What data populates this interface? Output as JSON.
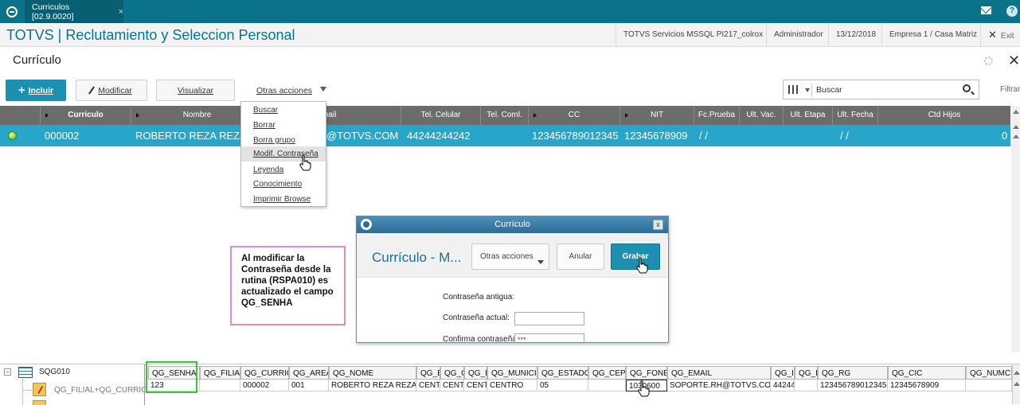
{
  "topbar": {
    "tab_label": "Curriculos [02.9.0020]",
    "tab_close": "×",
    "help": "?"
  },
  "header": {
    "app_title": "TOTVS | Reclutamiento y Seleccion Personal",
    "environment": "TOTVS Servicios MSSQL PI217_colrox",
    "user": "Administrador",
    "date": "13/12/2018",
    "company": "Empresa 1 / Casa Matriz",
    "exit_x": "✕",
    "exit_label": "Exit"
  },
  "page": {
    "title": "Currículo",
    "close": "✕"
  },
  "toolbar": {
    "incluir_plus": "+",
    "incluir": "Incluir",
    "modificar": "Modificar",
    "visualizar": "Visualizar",
    "otras": "Otras acciones"
  },
  "search": {
    "value": "Buscar",
    "filtrar": "Filtrar"
  },
  "grid": {
    "headers": {
      "curriculo": "Curriculo",
      "nombre": "Nombre",
      "email": "mail",
      "tel_celular": "Tel. Celular",
      "tel_coml": "Tel. Coml.",
      "cc": "CC",
      "nit": "NIT",
      "fc_prueba": "Fc.Prueba",
      "ult_vac": "Ult. Vac.",
      "ult_etapa": "Ult. Etapa",
      "ult_fecha": "Ult. Fecha",
      "ctd_hijos": "Ctd Hijos"
    },
    "row": {
      "curriculo": "000002",
      "nombre": "ROBERTO REZA REZA",
      "email": "@TOTVS.COM",
      "tel_celular": "44244244242",
      "cc": "123456789012345",
      "nit": "12345678909",
      "fc_prueba": "/ /",
      "ult_fecha": "/ /",
      "ctd_hijos": "0"
    }
  },
  "menu": {
    "items": [
      "Buscar",
      "Borrar",
      "Borra grupo",
      "Modif. Contraseña",
      "Leyenda",
      "Conocimiento",
      "Imprimir Browse"
    ]
  },
  "dialog": {
    "title": "Currículo",
    "close": "x",
    "heading": "Currículo - M...",
    "otras": "Otras acciones",
    "anular": "Anular",
    "grabar": "Grabar",
    "label_antigua": "Contraseña antigua:",
    "label_actual": "Contraseña actual:",
    "label_confirma": "Confirma contraseña",
    "confirma_value": "***"
  },
  "note": {
    "text": "Al modificar la Contraseña desde la rutina (RSPA010) es actualizado el campo QG_SENHA"
  },
  "tree": {
    "minus": "−",
    "root": "SQG010",
    "child": "QG_FILIAL+QG_CURRIC"
  },
  "dbgrid": {
    "headers": [
      "QG_SENHA",
      "QG_FILIAL",
      "QG_CURRIC",
      "QG_AREA",
      "QG_NOME",
      "QG_E",
      "QG_C",
      "QG_E",
      "QG_MUNICIP",
      "QG_ESTADO",
      "QG_CEP",
      "QG_FONE",
      "QG_EMAIL",
      "QG_I",
      "QG_I",
      "QG_RG",
      "QG_CIC",
      "QG_NUMCP"
    ],
    "row": [
      "123",
      "",
      "000002",
      "001",
      "ROBERTO REZA REZA",
      "CENT",
      "CENT",
      "CENT",
      "CENTRO",
      "05",
      "",
      "1030600",
      "SOPORTE.RH@TOTVS.COM",
      "44244",
      "",
      "123456789012345",
      "12345678909",
      ""
    ]
  },
  "colors": {
    "topbar": "#0b7389",
    "accent": "#1d8fb0",
    "row_selected": "#27a6c9",
    "grid_header": "#6c6c6c",
    "highlight_green": "#3bc43b",
    "note_border": "#e58bc8"
  }
}
